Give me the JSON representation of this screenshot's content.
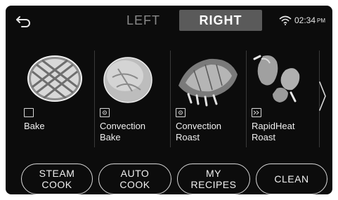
{
  "header": {
    "back_icon": "back-arrow-icon",
    "tabs": [
      {
        "label": "LEFT",
        "active": false
      },
      {
        "label": "RIGHT",
        "active": true
      }
    ],
    "status": {
      "wifi_icon": "wifi-icon",
      "time": "02:34",
      "ampm": "PM"
    }
  },
  "modes": [
    {
      "label": "Bake",
      "icon": "bake-icon",
      "image": "pie"
    },
    {
      "label": "Convection\nBake",
      "icon": "convection-fan-icon",
      "image": "bread-loaf"
    },
    {
      "label": "Convection\nRoast",
      "icon": "convection-fan-icon",
      "image": "rack-of-ribs"
    },
    {
      "label": "RapidHeat\nRoast",
      "icon": "rapidheat-icon",
      "image": "roast-chicken"
    }
  ],
  "next_icon": "chevron-right-icon",
  "buttons": [
    {
      "label": "STEAM\nCOOK"
    },
    {
      "label": "AUTO\nCOOK"
    },
    {
      "label": "MY\nRECIPES"
    },
    {
      "label": "CLEAN"
    }
  ],
  "colors": {
    "screen_bg": "#0c0c0c",
    "active_tab_bg": "#5a5a5a",
    "inactive_tab_text": "#8a8a8a",
    "text": "#f0f0f0"
  }
}
